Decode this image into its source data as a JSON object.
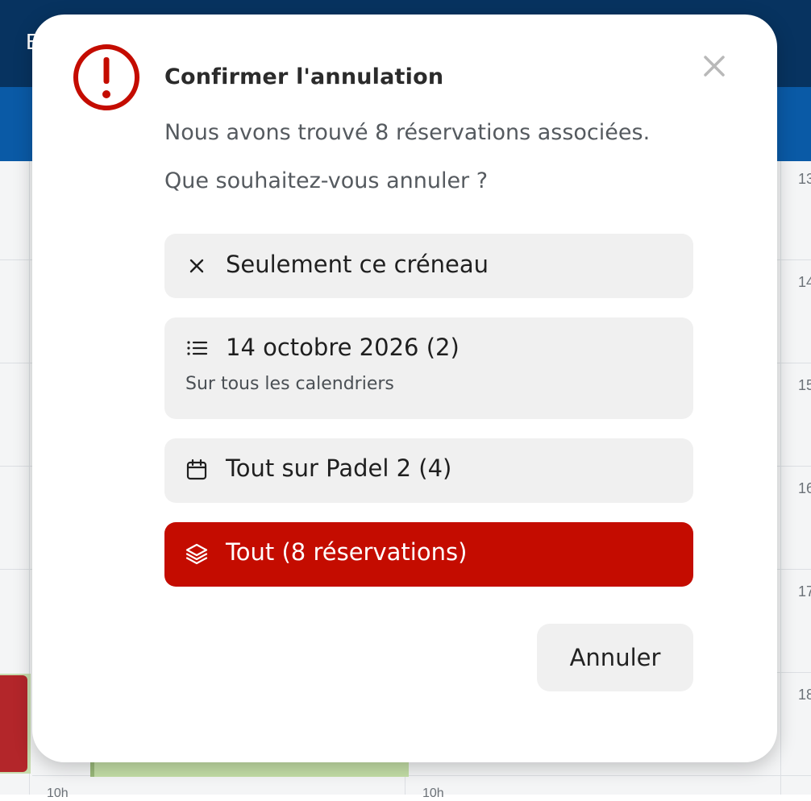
{
  "background": {
    "brand_letter": "E",
    "hour_labels": [
      "13",
      "14",
      "15",
      "16",
      "17",
      "18"
    ],
    "bottom_hour_labels": [
      "10h",
      "10h"
    ]
  },
  "dialog": {
    "title": "Confirmer l'annulation",
    "message_line1": "Nous avons trouvé 8 réservations associées.",
    "message_line2": "Que souhaitez-vous annuler ?",
    "options": [
      {
        "id": "slot",
        "icon": "close-icon",
        "label": "Seulement ce créneau"
      },
      {
        "id": "day",
        "icon": "list-icon",
        "label": "14 octobre 2026 (2)",
        "sublabel": "Sur tous les calendriers"
      },
      {
        "id": "court",
        "icon": "calendar-icon",
        "label": "Tout sur Padel 2 (4)"
      },
      {
        "id": "all",
        "icon": "layers-icon",
        "label": "Tout (8 réservations)"
      }
    ],
    "cancel_label": "Annuler"
  },
  "colors": {
    "danger": "#c40c00",
    "topbar": "#073360",
    "subbar": "#0a5aa6",
    "option_bg": "#f0f0f0"
  }
}
